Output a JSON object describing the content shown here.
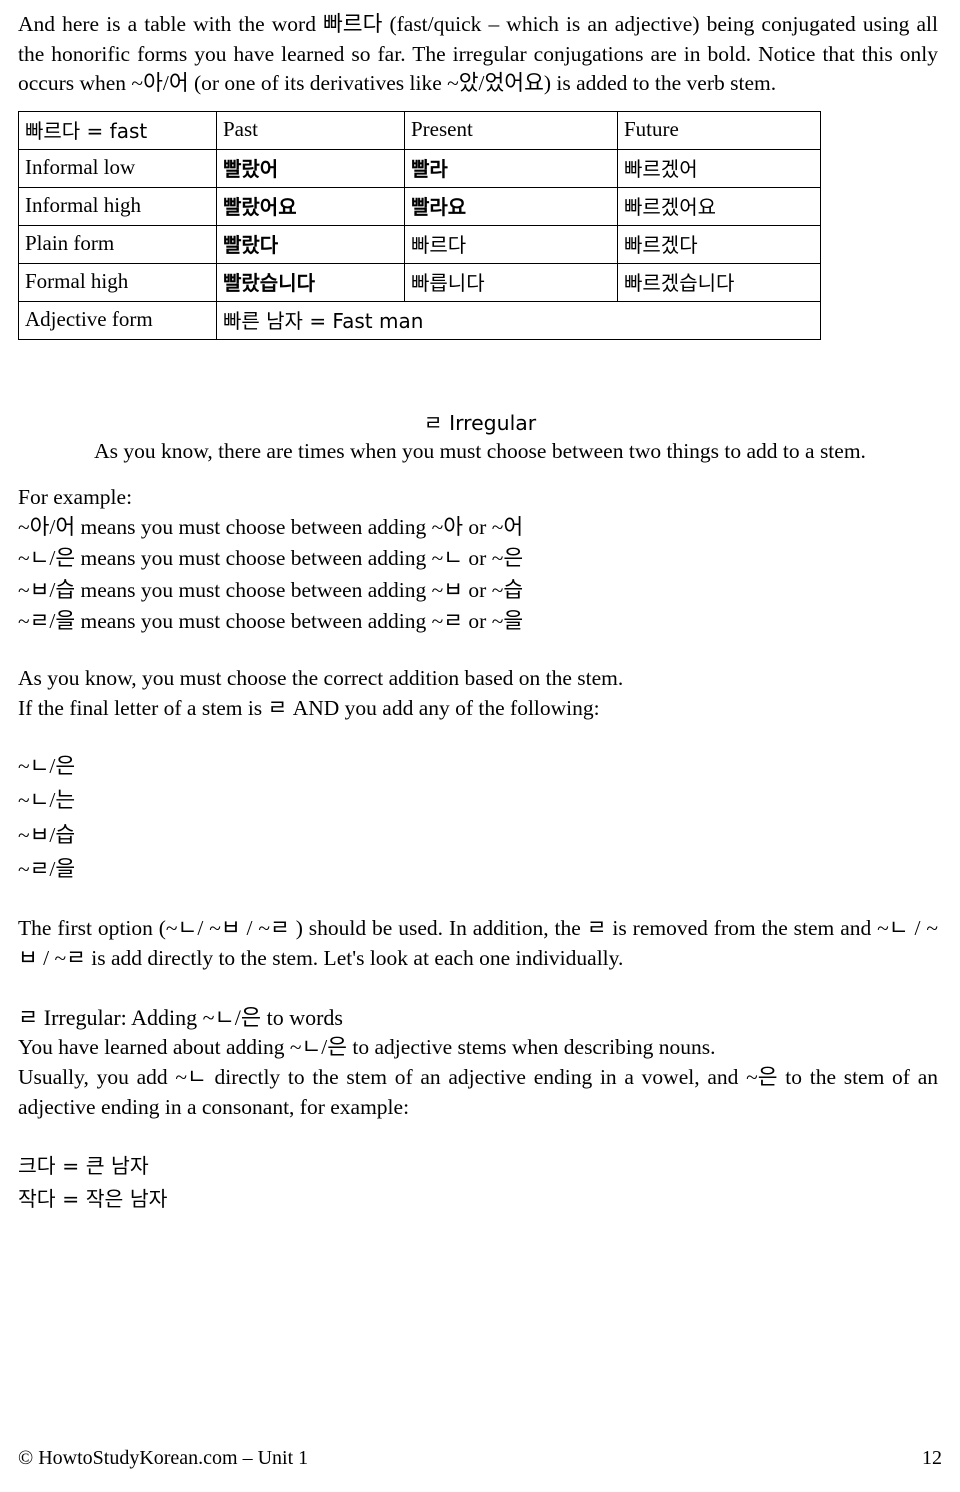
{
  "intro": {
    "paragraph": "And here is a table with the word 빠르다 (fast/quick – which is an adjective) being conjugated using all the honorific forms you have learned so far. The irregular conjugations are in bold. Notice that this only occurs when ~아/어 (or one of its derivatives like ~았/었어요) is added to the verb stem."
  },
  "table": {
    "headers": [
      "빠르다 = fast",
      "Past",
      "Present",
      "Future"
    ],
    "rows": [
      {
        "label": "Informal low",
        "past": "빨랐어",
        "present": "빨라",
        "future": "빠르겠어"
      },
      {
        "label": "Informal high",
        "past": "빨랐어요",
        "present": "빨라요",
        "future": "빠르겠어요"
      },
      {
        "label": "Plain form",
        "past": "빨랐다",
        "present": "빠르다",
        "future": "빠르겠다"
      },
      {
        "label": "Formal high",
        "past": "빨랐습니다",
        "present": "빠릅니다",
        "future": "빠르겠습니다"
      }
    ],
    "adjective_row": {
      "label": "Adjective form",
      "value": "빠른 남자 = Fast man"
    }
  },
  "irregular_section": {
    "heading": "ㄹ Irregular",
    "line1": "As you know, there are times when you must choose between two things to add to a stem.",
    "for_example": "For example:",
    "choices": [
      "~아/어 means you must choose between adding ~아 or ~어",
      "~ㄴ/은 means you must choose between adding ~ㄴ or ~은",
      "~ㅂ/습 means you must choose between adding ~ㅂ or ~습",
      "~ㄹ/을 means you must choose between adding ~ㄹ or ~을"
    ],
    "rule_intro_1": "As you know, you must choose the correct addition based on the stem.",
    "rule_intro_2": "If the final letter of a stem is ㄹ AND you add any of the following:",
    "additions": [
      "~ㄴ/은",
      "~ㄴ/는",
      "~ㅂ/습",
      "~ㄹ/을"
    ],
    "rule_explanation": "The first option (~ㄴ/ ~ㅂ / ~ㄹ ) should be used. In addition, the ㄹ is removed from the stem and ~ㄴ / ~ㅂ / ~ㄹ is add directly to the stem. Let's look at each one individually."
  },
  "adding_section": {
    "heading": "ㄹ Irregular: Adding ~ㄴ/은 to words",
    "line1": "You have learned about adding ~ㄴ/은 to adjective stems when describing nouns.",
    "line2": "Usually, you add ~ㄴ directly to the stem of an adjective ending in a vowel, and ~은 to the stem of an adjective ending in a consonant, for example:",
    "examples": [
      "크다 = 큰 남자",
      "작다 = 작은 남자"
    ]
  },
  "footer": {
    "left": "© HowtoStudyKorean.com – Unit 1",
    "right": "12"
  }
}
